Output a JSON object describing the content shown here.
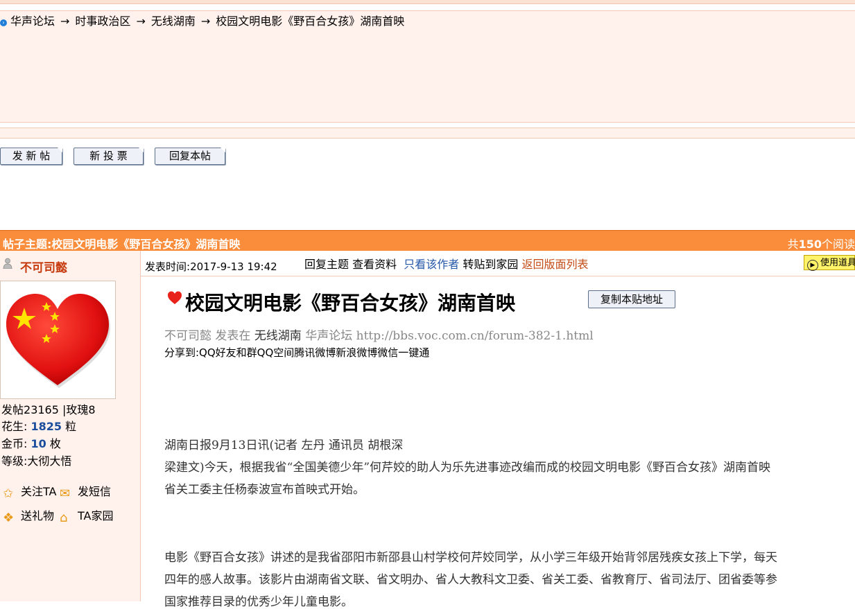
{
  "breadcrumb": {
    "items": [
      "华声论坛",
      "时事政治区",
      "无线湖南",
      "校园文明电影《野百合女孩》湖南首映"
    ],
    "separator": "→"
  },
  "buttons": {
    "new_post": "发 新 帖",
    "new_poll": "新 投 票",
    "reply": "回复本帖"
  },
  "subject_bar": {
    "title": "帖子主题:校园文明电影《野百合女孩》湖南首映",
    "count_prefix": "共",
    "count": "150",
    "count_suffix": "个阅读"
  },
  "author": {
    "name": "不可司懿",
    "stats": {
      "posts_label": "发帖",
      "posts": "23165",
      "rose_label": "|玫瑰",
      "rose": "8",
      "peanut_label": "花生:",
      "peanut": "1825",
      "peanut_unit": "粒",
      "coin_label": "金币:",
      "coin": "10",
      "coin_unit": "枚",
      "level_label": "等级:",
      "level": "大彻大悟"
    },
    "actions": {
      "follow": "关注TA",
      "message": "发短信",
      "gift": "送礼物",
      "home": "TA家园"
    }
  },
  "meta": {
    "time_label": "发表时间:",
    "time": "2017-9-13 19:42",
    "reply": "回复主题",
    "profile": "查看资料",
    "only_author": "只看该作者",
    "forward": "转贴到家园",
    "back": "返回版面列表",
    "use_prop": "使用道具"
  },
  "post": {
    "title": "校园文明电影《野百合女孩》湖南首映",
    "copy_btn": "复制本贴地址",
    "byline_author": "不可司懿",
    "byline_posted": "发表在",
    "byline_forum": "无线湖南",
    "byline_site": "华声论坛",
    "byline_url": "http://bbs.voc.com.cn/forum-382-1.html",
    "share": "分享到:QQ好友和群QQ空间腾讯微博新浪微博微信一键通",
    "para1_line1": "湖南日报9月13日讯(记者 左丹 通讯员 胡根深",
    "para1_line2": "梁建文)今天，根据我省“全国美德少年”何芹姣的助人为乐先进事迹改编而成的校园文明电影《野百合女孩》湖南首映",
    "para1_line3": "省关工委主任杨泰波宣布首映式开始。",
    "para2_line1": "电影《野百合女孩》讲述的是我省邵阳市新邵县山村学校何芹姣同学，从小学三年级开始背邻居残疾女孩上下学，每天",
    "para2_line2": "四年的感人故事。该影片由湖南省文联、省文明办、省人大教科文卫委、省关工委、省教育厅、省司法厅、团省委等参",
    "para2_line3": "国家推荐目录的优秀少年儿童电影。"
  }
}
